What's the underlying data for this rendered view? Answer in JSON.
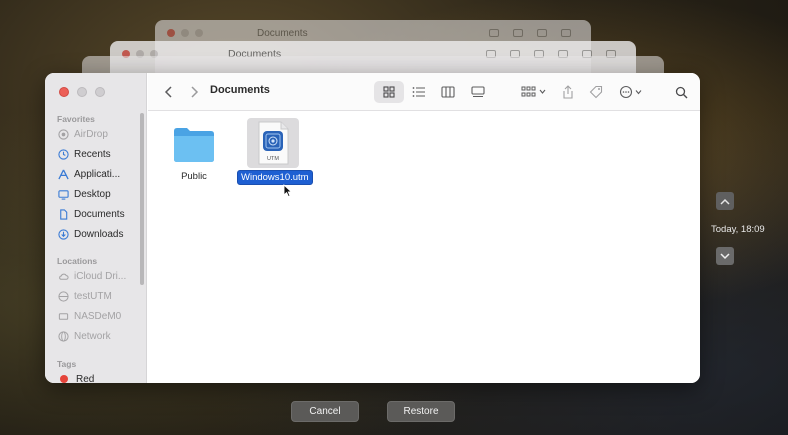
{
  "background_windows": {
    "title": "Documents"
  },
  "window": {
    "title": "Documents"
  },
  "sidebar": {
    "favorites_header": "Favorites",
    "favorites": [
      {
        "label": "AirDrop",
        "icon": "airdrop-icon",
        "dim": true
      },
      {
        "label": "Recents",
        "icon": "clock-icon"
      },
      {
        "label": "Applicati...",
        "icon": "applications-icon"
      },
      {
        "label": "Desktop",
        "icon": "desktop-icon"
      },
      {
        "label": "Documents",
        "icon": "document-icon"
      },
      {
        "label": "Downloads",
        "icon": "download-icon"
      }
    ],
    "locations_header": "Locations",
    "locations": [
      {
        "label": "iCloud Dri...",
        "icon": "cloud-icon",
        "dim": true
      },
      {
        "label": "testUTM",
        "icon": "network-drive-icon",
        "dim": true
      },
      {
        "label": "NASDeM0",
        "icon": "network-drive-icon",
        "dim": true
      },
      {
        "label": "Network",
        "icon": "globe-icon",
        "dim": true
      }
    ],
    "tags_header": "Tags",
    "tags": [
      {
        "label": "Red",
        "color": "#e5443a"
      }
    ]
  },
  "files": [
    {
      "name": "Public",
      "kind": "folder",
      "color": "#5fb3ea"
    },
    {
      "name": "Windows10.utm",
      "kind": "utm",
      "badge": "UTM",
      "selected": true
    }
  ],
  "timeline": {
    "label": "Today, 18:09"
  },
  "buttons": {
    "cancel": "Cancel",
    "restore": "Restore"
  },
  "colors": {
    "accent": "#1e5fd2",
    "close": "#ec5f57"
  }
}
